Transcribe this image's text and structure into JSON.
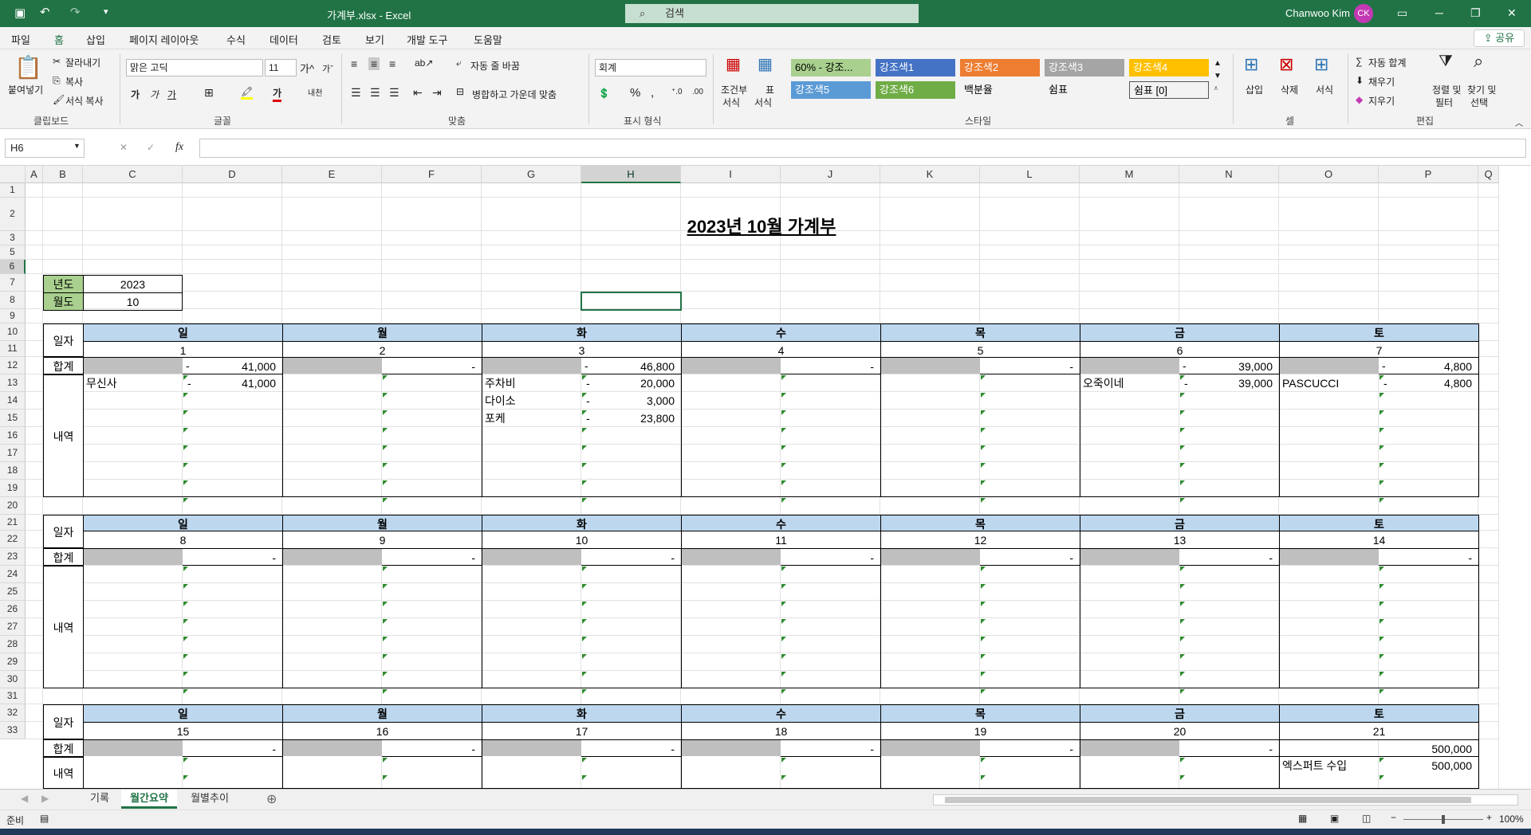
{
  "window": {
    "doc_title": "가계부.xlsx  -  Excel",
    "search_placeholder": "검색",
    "user": "Chanwoo Kim",
    "avatar": "CK"
  },
  "menu": [
    "파일",
    "홈",
    "삽입",
    "페이지 레이아웃",
    "수식",
    "데이터",
    "검토",
    "보기",
    "개발 도구",
    "도움말"
  ],
  "share_label": "공유",
  "ribbon": {
    "paste": "붙여넣기",
    "cut": "잘라내기",
    "copy": "복사",
    "format_painter": "서식 복사",
    "clipboard_group": "클립보드",
    "font_name": "맑은 고딕",
    "font_size": "11",
    "font_group": "글꼴",
    "wrap_text": "자동 줄 바꿈",
    "merge_center": "병합하고 가운데 맞춤",
    "align_group": "맞춤",
    "number_format": "회계",
    "number_group": "표시 형식",
    "cond_format_1": "조건부",
    "cond_format_2": "서식",
    "table_format_1": "표",
    "table_format_2": "서식",
    "styles": [
      "60% - 강조...",
      "강조색1",
      "강조색2",
      "강조색3",
      "강조색4",
      "강조색5",
      "강조색6",
      "백분율",
      "쉼표",
      "쉼표 [0]"
    ],
    "styles_group": "스타일",
    "insert": "삽입",
    "delete": "삭제",
    "format": "서식",
    "cells_group": "셀",
    "autosum": "자동 합계",
    "fill": "채우기",
    "clear": "지우기",
    "sort_filter_1": "정렬 및",
    "sort_filter_2": "필터",
    "find_select_1": "찾기 및",
    "find_select_2": "선택",
    "editing_group": "편집"
  },
  "name_box": "H6",
  "fx": "fx",
  "columns": [
    "A",
    "B",
    "C",
    "D",
    "E",
    "F",
    "G",
    "H",
    "I",
    "J",
    "K",
    "L",
    "M",
    "N",
    "O",
    "P",
    "Q"
  ],
  "rows": [
    "1",
    "2",
    "3",
    "5",
    "6",
    "7",
    "8",
    "9",
    "10",
    "11",
    "12",
    "13",
    "14",
    "15",
    "16",
    "17",
    "18",
    "19",
    "20",
    "21",
    "22",
    "23",
    "24",
    "25",
    "26",
    "27",
    "28",
    "29",
    "30",
    "31",
    "32",
    "33"
  ],
  "sheet": {
    "title": "2023년 10월 가계부",
    "year_label": "년도",
    "year_value": "2023",
    "month_label": "월도",
    "month_value": "10",
    "day_label": "일자",
    "sum_label": "합계",
    "detail_label": "내역",
    "weekdays": [
      "일",
      "월",
      "화",
      "수",
      "목",
      "금",
      "토"
    ],
    "weeks": [
      {
        "dates": [
          "1",
          "2",
          "3",
          "4",
          "5",
          "6",
          "7"
        ],
        "totals": [
          "41,000",
          "-",
          "46,800",
          "-",
          "-",
          "39,000",
          "4,800"
        ]
      },
      {
        "dates": [
          "8",
          "9",
          "10",
          "11",
          "12",
          "13",
          "14"
        ],
        "totals": [
          "-",
          "-",
          "-",
          "-",
          "-",
          "-",
          "-"
        ]
      },
      {
        "dates": [
          "15",
          "16",
          "17",
          "18",
          "19",
          "20",
          "21"
        ],
        "totals": [
          "-",
          "-",
          "-",
          "-",
          "-",
          "-",
          "500,000"
        ]
      }
    ],
    "dash": "-",
    "entries": [
      {
        "day": 0,
        "row": 0,
        "name": "무신사",
        "amount": "41,000"
      },
      {
        "day": 2,
        "row": 0,
        "name": "주차비",
        "amount": "20,000"
      },
      {
        "day": 2,
        "row": 1,
        "name": "다이소",
        "amount": "3,000"
      },
      {
        "day": 2,
        "row": 2,
        "name": "포케",
        "amount": "23,800"
      },
      {
        "day": 5,
        "row": 0,
        "name": "오죽이네",
        "amount": "39,000"
      },
      {
        "day": 6,
        "row": 0,
        "name": "PASCUCCI",
        "amount": "4,800"
      },
      {
        "day": 6,
        "row": 1,
        "name": "엑스퍼트 수입",
        "amount": "500,000"
      }
    ]
  },
  "sheet_tabs": [
    "기록",
    "월간요약",
    "월별추이"
  ],
  "active_tab": 1,
  "status": {
    "ready": "준비",
    "zoom": "100%"
  },
  "colors": {
    "excel_green": "#217346",
    "header_blue": "#bdd7ee",
    "sum_gray": "#bfbfbf"
  }
}
